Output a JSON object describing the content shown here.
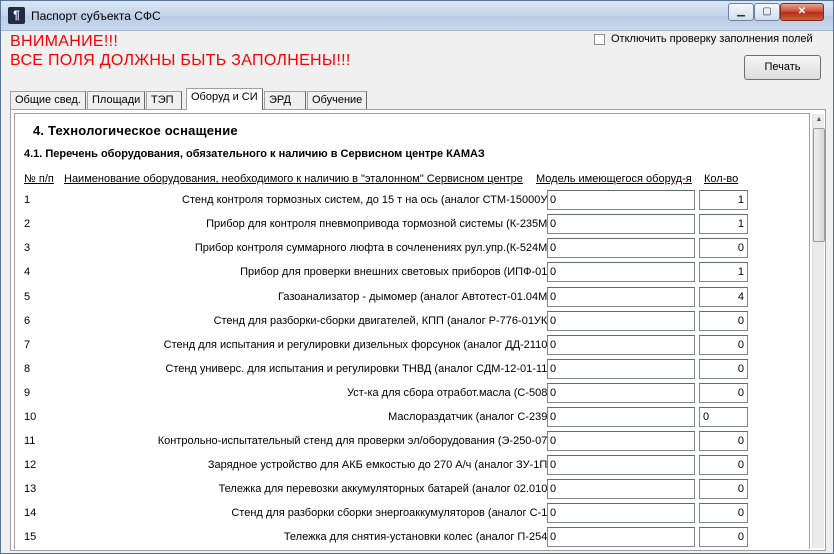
{
  "window": {
    "title": "Паспорт субъекта СФС"
  },
  "warning": {
    "line1": "ВНИМАНИЕ!!!",
    "line2": "ВСЕ ПОЛЯ ДОЛЖНЫ БЫТЬ ЗАПОЛНЕНЫ!!!"
  },
  "options": {
    "disable_check_label": "Отключить проверку заполнения полей",
    "disable_check_checked": false
  },
  "toolbar": {
    "print_label": "Печать"
  },
  "tabs": [
    {
      "label": "Общие свед.",
      "active": false
    },
    {
      "label": "Площади",
      "active": false
    },
    {
      "label": "ТЭП",
      "active": false
    },
    {
      "label": "Оборуд и СИ",
      "active": true
    },
    {
      "label": "ЭРД",
      "active": false
    },
    {
      "label": "Обучение",
      "active": false
    }
  ],
  "section": {
    "title": "4. Технологическое оснащение",
    "subtitle": "4.1. Перечень оборудования, обязательного к наличию в Сервисном центре КАМАЗ"
  },
  "columns": {
    "num": "№ п/п",
    "name": "Наименование оборудования, необходимого к наличию в \"эталонном\" Сервисном центре",
    "model": "Модель имеющегося оборуд-я",
    "qty": "Кол-во"
  },
  "rows": [
    {
      "num": "1",
      "name": "Стенд контроля тормозных систем, до 15 т на ось (аналог СТМ-15000У)",
      "model": "0",
      "qty": "1"
    },
    {
      "num": "2",
      "name": "Прибор для контроля пневмопривода тормозной системы (К-235М)",
      "model": "0",
      "qty": "1"
    },
    {
      "num": "3",
      "name": "Прибор контроля суммарного люфта в сочленениях рул.упр.(К-524М)",
      "model": "0",
      "qty": "0"
    },
    {
      "num": "4",
      "name": "Прибор для проверки внешних световых приборов (ИПФ-01)",
      "model": "0",
      "qty": "1"
    },
    {
      "num": "5",
      "name": "Газоанализатор - дымомер (аналог Автотест-01.04М)",
      "model": "0",
      "qty": "4"
    },
    {
      "num": "6",
      "name": "Стенд для разборки-сборки двигателей, КПП (аналог Р-776-01УК)",
      "model": "0",
      "qty": "0"
    },
    {
      "num": "7",
      "name": "Стенд для испытания и регулировки дизельных форсунок (аналог ДД-2110)",
      "model": "0",
      "qty": "0"
    },
    {
      "num": "8",
      "name": "Стенд универс. для испытания и регулировки ТНВД (аналог СДМ-12-01-11)",
      "model": "0",
      "qty": "0"
    },
    {
      "num": "9",
      "name": "Уст-ка для сбора отработ.масла (С-508)",
      "model": "0",
      "qty": "0"
    },
    {
      "num": "10",
      "name": "Маслораздатчик (аналог С-239)",
      "model": "0",
      "qty": "0"
    },
    {
      "num": "11",
      "name": "Контрольно-испытательный стенд для проверки эл/оборудования (Э-250-07)",
      "model": "0",
      "qty": "0"
    },
    {
      "num": "12",
      "name": "Зарядное устройство для АКБ емкостью до 270 А/ч (аналог ЗУ-1П)",
      "model": "0",
      "qty": "0"
    },
    {
      "num": "13",
      "name": "Тележка для перевозки аккумуляторных батарей (аналог 02.010)",
      "model": "0",
      "qty": "0"
    },
    {
      "num": "14",
      "name": "Стенд для разборки сборки энергоаккумуляторов (аналог С-1)",
      "model": "0",
      "qty": "0"
    },
    {
      "num": "15",
      "name": "Тележка для снятия-установки колес (аналог П-254)",
      "model": "0",
      "qty": "0"
    }
  ]
}
